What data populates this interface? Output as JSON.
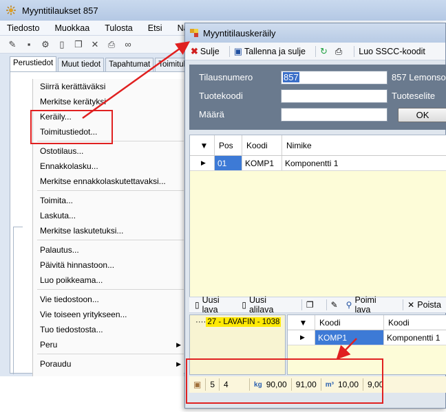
{
  "back_window": {
    "title": "Myyntitilaukset 857",
    "menu": [
      "Tiedosto",
      "Muokkaa",
      "Tulosta",
      "Etsi",
      "Nä"
    ],
    "tabs": [
      "Perustiedot",
      "Muut tiedot",
      "Tapahtumat",
      "Toimituks"
    ]
  },
  "context_menu": {
    "items": {
      "siirra": "Siirrä kerättäväksi",
      "merkitse_keratyksi": "Merkitse kerätyksi",
      "keraily": "Keräily...",
      "toimitustiedot": "Toimitustiedot...",
      "ostotilaus": "Ostotilaus...",
      "ennakkolasku": "Ennakkolasku...",
      "merkitse_ennakko": "Merkitse ennakkolaskutettavaksi...",
      "toimita": "Toimita...",
      "laskuta": "Laskuta...",
      "merkitse_laskutetuksi": "Merkitse laskutetuksi...",
      "palautus": "Palautus...",
      "paivita_hinnastoon": "Päivitä hinnastoon...",
      "luo_poikkeama": "Luo poikkeama...",
      "vie_tiedostoon": "Vie tiedostoon...",
      "vie_toiseen": "Vie toiseen yritykseen...",
      "tuo_tiedostosta": "Tuo tiedostosta...",
      "peru": "Peru",
      "poraudu": "Poraudu"
    }
  },
  "front_window": {
    "title": "Myyntitilauskeräily",
    "toolbar": {
      "close": "Sulje",
      "save_close": "Tallenna ja sulje",
      "sscc": "Luo SSCC-koodit"
    },
    "form": {
      "order_label": "Tilausnumero",
      "order_value": "857",
      "order_right": "857 Lemonso",
      "product_label": "Tuotekoodi",
      "product_right": "Tuoteselite",
      "qty_label": "Määrä",
      "ok": "OK"
    },
    "grid1": {
      "headers": [
        "Pos",
        "Koodi",
        "Nimike"
      ],
      "row": {
        "pos": "01",
        "code": "KOMP1",
        "name": "Komponentti 1"
      }
    },
    "lower_toolbar": {
      "new_pallet": "Uusi lava",
      "new_subpallet": "Uusi alilava",
      "pick_pallet": "Poimi lava",
      "delete": "Poista"
    },
    "tree": {
      "node": "27 - LAVAFIN - 1038"
    },
    "grid2": {
      "headers": [
        "Koodi",
        "Koodi"
      ],
      "row": {
        "code": "KOMP1",
        "name": "Komponentti 1"
      }
    },
    "status": {
      "count": "5",
      "count2": "4",
      "kg_label": "kg",
      "weight": "90,00",
      "weight2": "91,00",
      "m3_label": "m³",
      "volume": "10,00",
      "volume2": "9,00"
    }
  },
  "colors": {
    "highlight_red": "#e02020",
    "selection_blue": "#3d7ad6",
    "form_panel": "#6a7a8e"
  }
}
